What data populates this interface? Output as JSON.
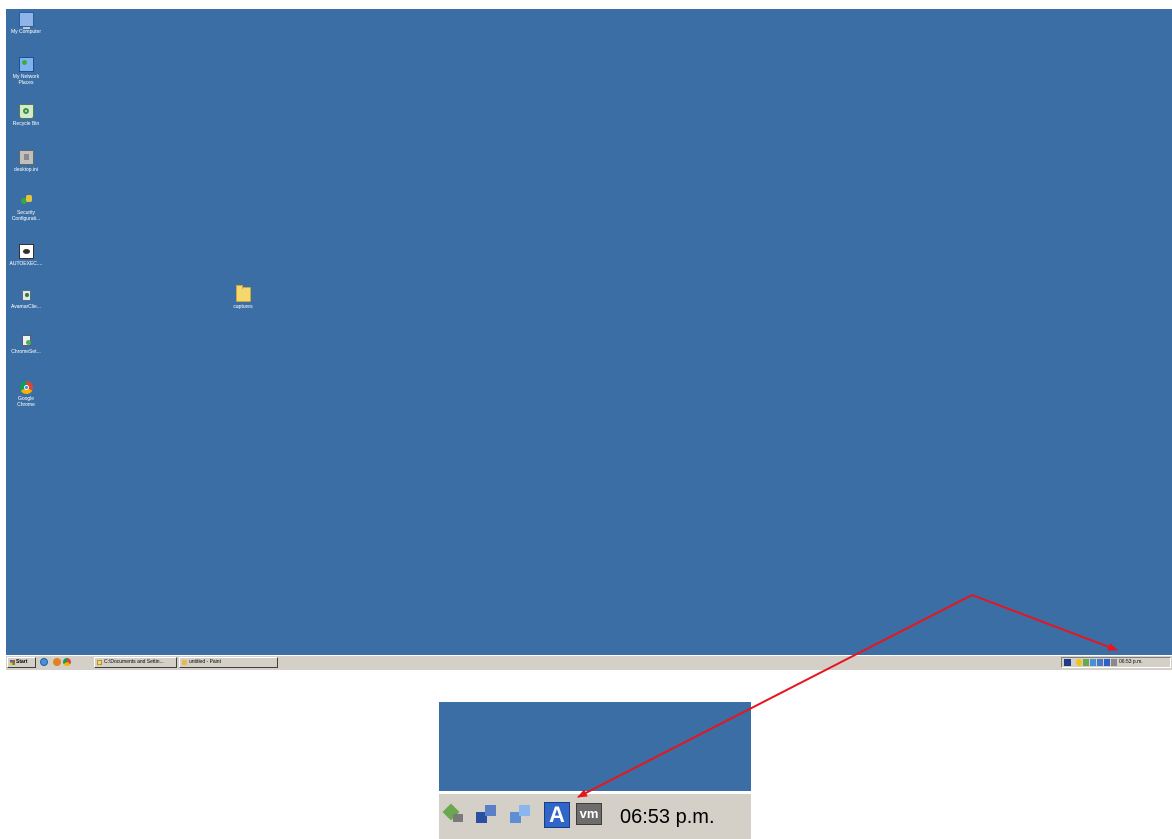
{
  "desktop": {
    "icons": [
      {
        "label": "My Computer"
      },
      {
        "label": "My Network\nPlaces"
      },
      {
        "label": "Recycle Bin"
      },
      {
        "label": "desktop.ini"
      },
      {
        "label": "Security\nConfigurati..."
      },
      {
        "label": "AUTOEXEC...."
      },
      {
        "label": "AvamarClie..."
      },
      {
        "label": "ChromeSet..."
      },
      {
        "label": "Google\nChrome"
      },
      {
        "label": "captures"
      }
    ]
  },
  "taskbar": {
    "start_label": "Start",
    "tasks": [
      {
        "label": "C:\\Documents and Settin..."
      },
      {
        "label": "untitled - Paint"
      }
    ],
    "clock": "06:53 p.m."
  },
  "zoom": {
    "tray_a_label": "A",
    "tray_vm_label": "vm",
    "clock": "06:53 p.m."
  },
  "annotation": {
    "arrow_color": "#e8141e"
  },
  "colors": {
    "desktop_background": "#3a6ea5",
    "taskbar_background": "#d4d0c8"
  }
}
